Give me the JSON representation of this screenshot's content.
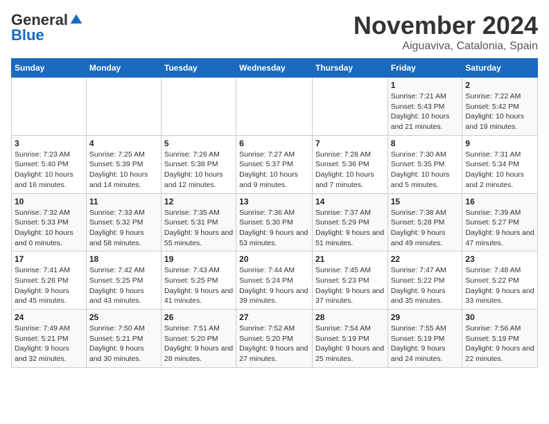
{
  "logo": {
    "general": "General",
    "blue": "Blue"
  },
  "title": "November 2024",
  "location": "Aiguaviva, Catalonia, Spain",
  "weekdays": [
    "Sunday",
    "Monday",
    "Tuesday",
    "Wednesday",
    "Thursday",
    "Friday",
    "Saturday"
  ],
  "weeks": [
    [
      {
        "day": "",
        "info": ""
      },
      {
        "day": "",
        "info": ""
      },
      {
        "day": "",
        "info": ""
      },
      {
        "day": "",
        "info": ""
      },
      {
        "day": "",
        "info": ""
      },
      {
        "day": "1",
        "info": "Sunrise: 7:21 AM\nSunset: 5:43 PM\nDaylight: 10 hours and 21 minutes."
      },
      {
        "day": "2",
        "info": "Sunrise: 7:22 AM\nSunset: 5:42 PM\nDaylight: 10 hours and 19 minutes."
      }
    ],
    [
      {
        "day": "3",
        "info": "Sunrise: 7:23 AM\nSunset: 5:40 PM\nDaylight: 10 hours and 16 minutes."
      },
      {
        "day": "4",
        "info": "Sunrise: 7:25 AM\nSunset: 5:39 PM\nDaylight: 10 hours and 14 minutes."
      },
      {
        "day": "5",
        "info": "Sunrise: 7:26 AM\nSunset: 5:38 PM\nDaylight: 10 hours and 12 minutes."
      },
      {
        "day": "6",
        "info": "Sunrise: 7:27 AM\nSunset: 5:37 PM\nDaylight: 10 hours and 9 minutes."
      },
      {
        "day": "7",
        "info": "Sunrise: 7:28 AM\nSunset: 5:36 PM\nDaylight: 10 hours and 7 minutes."
      },
      {
        "day": "8",
        "info": "Sunrise: 7:30 AM\nSunset: 5:35 PM\nDaylight: 10 hours and 5 minutes."
      },
      {
        "day": "9",
        "info": "Sunrise: 7:31 AM\nSunset: 5:34 PM\nDaylight: 10 hours and 2 minutes."
      }
    ],
    [
      {
        "day": "10",
        "info": "Sunrise: 7:32 AM\nSunset: 5:33 PM\nDaylight: 10 hours and 0 minutes."
      },
      {
        "day": "11",
        "info": "Sunrise: 7:33 AM\nSunset: 5:32 PM\nDaylight: 9 hours and 58 minutes."
      },
      {
        "day": "12",
        "info": "Sunrise: 7:35 AM\nSunset: 5:31 PM\nDaylight: 9 hours and 55 minutes."
      },
      {
        "day": "13",
        "info": "Sunrise: 7:36 AM\nSunset: 5:30 PM\nDaylight: 9 hours and 53 minutes."
      },
      {
        "day": "14",
        "info": "Sunrise: 7:37 AM\nSunset: 5:29 PM\nDaylight: 9 hours and 51 minutes."
      },
      {
        "day": "15",
        "info": "Sunrise: 7:38 AM\nSunset: 5:28 PM\nDaylight: 9 hours and 49 minutes."
      },
      {
        "day": "16",
        "info": "Sunrise: 7:39 AM\nSunset: 5:27 PM\nDaylight: 9 hours and 47 minutes."
      }
    ],
    [
      {
        "day": "17",
        "info": "Sunrise: 7:41 AM\nSunset: 5:26 PM\nDaylight: 9 hours and 45 minutes."
      },
      {
        "day": "18",
        "info": "Sunrise: 7:42 AM\nSunset: 5:25 PM\nDaylight: 9 hours and 43 minutes."
      },
      {
        "day": "19",
        "info": "Sunrise: 7:43 AM\nSunset: 5:25 PM\nDaylight: 9 hours and 41 minutes."
      },
      {
        "day": "20",
        "info": "Sunrise: 7:44 AM\nSunset: 5:24 PM\nDaylight: 9 hours and 39 minutes."
      },
      {
        "day": "21",
        "info": "Sunrise: 7:45 AM\nSunset: 5:23 PM\nDaylight: 9 hours and 37 minutes."
      },
      {
        "day": "22",
        "info": "Sunrise: 7:47 AM\nSunset: 5:22 PM\nDaylight: 9 hours and 35 minutes."
      },
      {
        "day": "23",
        "info": "Sunrise: 7:48 AM\nSunset: 5:22 PM\nDaylight: 9 hours and 33 minutes."
      }
    ],
    [
      {
        "day": "24",
        "info": "Sunrise: 7:49 AM\nSunset: 5:21 PM\nDaylight: 9 hours and 32 minutes."
      },
      {
        "day": "25",
        "info": "Sunrise: 7:50 AM\nSunset: 5:21 PM\nDaylight: 9 hours and 30 minutes."
      },
      {
        "day": "26",
        "info": "Sunrise: 7:51 AM\nSunset: 5:20 PM\nDaylight: 9 hours and 28 minutes."
      },
      {
        "day": "27",
        "info": "Sunrise: 7:52 AM\nSunset: 5:20 PM\nDaylight: 9 hours and 27 minutes."
      },
      {
        "day": "28",
        "info": "Sunrise: 7:54 AM\nSunset: 5:19 PM\nDaylight: 9 hours and 25 minutes."
      },
      {
        "day": "29",
        "info": "Sunrise: 7:55 AM\nSunset: 5:19 PM\nDaylight: 9 hours and 24 minutes."
      },
      {
        "day": "30",
        "info": "Sunrise: 7:56 AM\nSunset: 5:19 PM\nDaylight: 9 hours and 22 minutes."
      }
    ]
  ]
}
